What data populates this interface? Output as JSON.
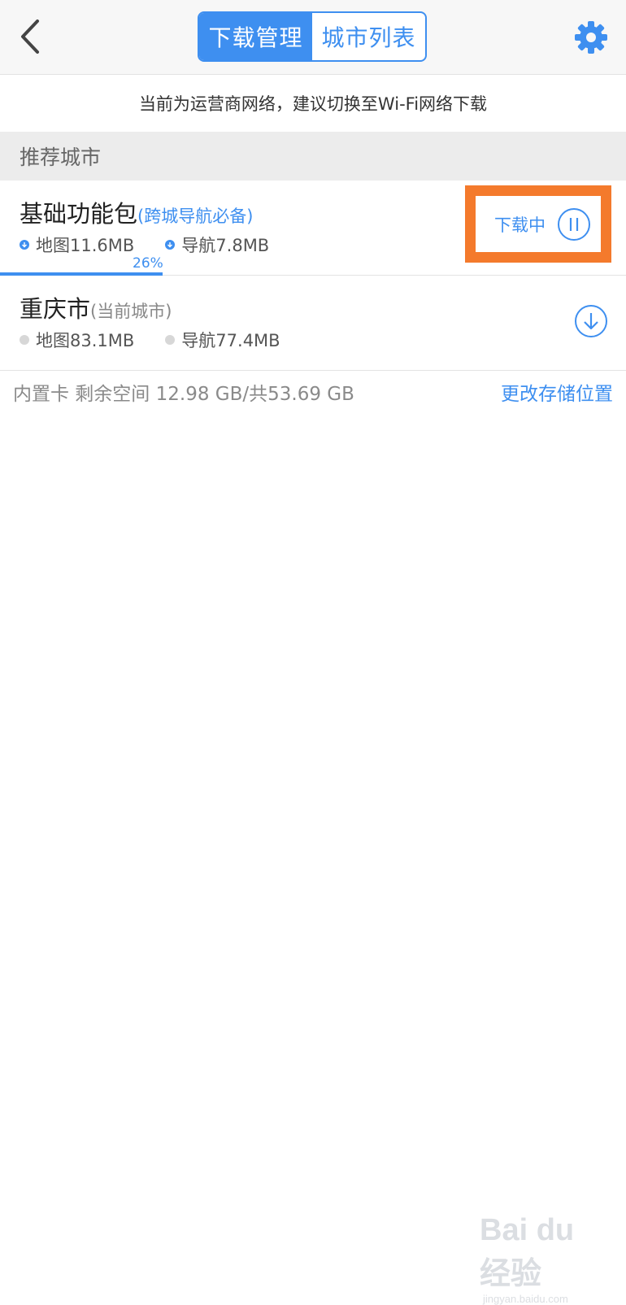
{
  "header": {
    "back_icon": "chevron-left-icon",
    "tabs": [
      {
        "label": "下载管理",
        "active": true
      },
      {
        "label": "城市列表",
        "active": false
      }
    ],
    "settings_icon": "gear-icon",
    "accent_color": "#3e8ff0"
  },
  "banner": {
    "text": "当前为运营商网络，建议切换至Wi-Fi网络下载"
  },
  "section": {
    "title": "推荐城市"
  },
  "items": [
    {
      "title": "基础功能包",
      "subtitle": "(跨城导航必备)",
      "map_size": "地图11.6MB",
      "nav_size": "导航7.8MB",
      "progress_text": "26%",
      "progress": 0.26,
      "status_label": "下载中",
      "status_icon": "pause-icon",
      "highlight_color": "#f47a2c"
    },
    {
      "title": "重庆市",
      "subtitle": "(当前城市)",
      "map_size": "地图83.1MB",
      "nav_size": "导航77.4MB",
      "status_icon": "download-icon"
    }
  ],
  "storage": {
    "info": "内置卡 剩余空间 12.98 GB/共53.69 GB",
    "change_label": "更改存储位置"
  },
  "watermark": {
    "main": "Bai du 经验",
    "sub": "jingyan.baidu.com"
  }
}
